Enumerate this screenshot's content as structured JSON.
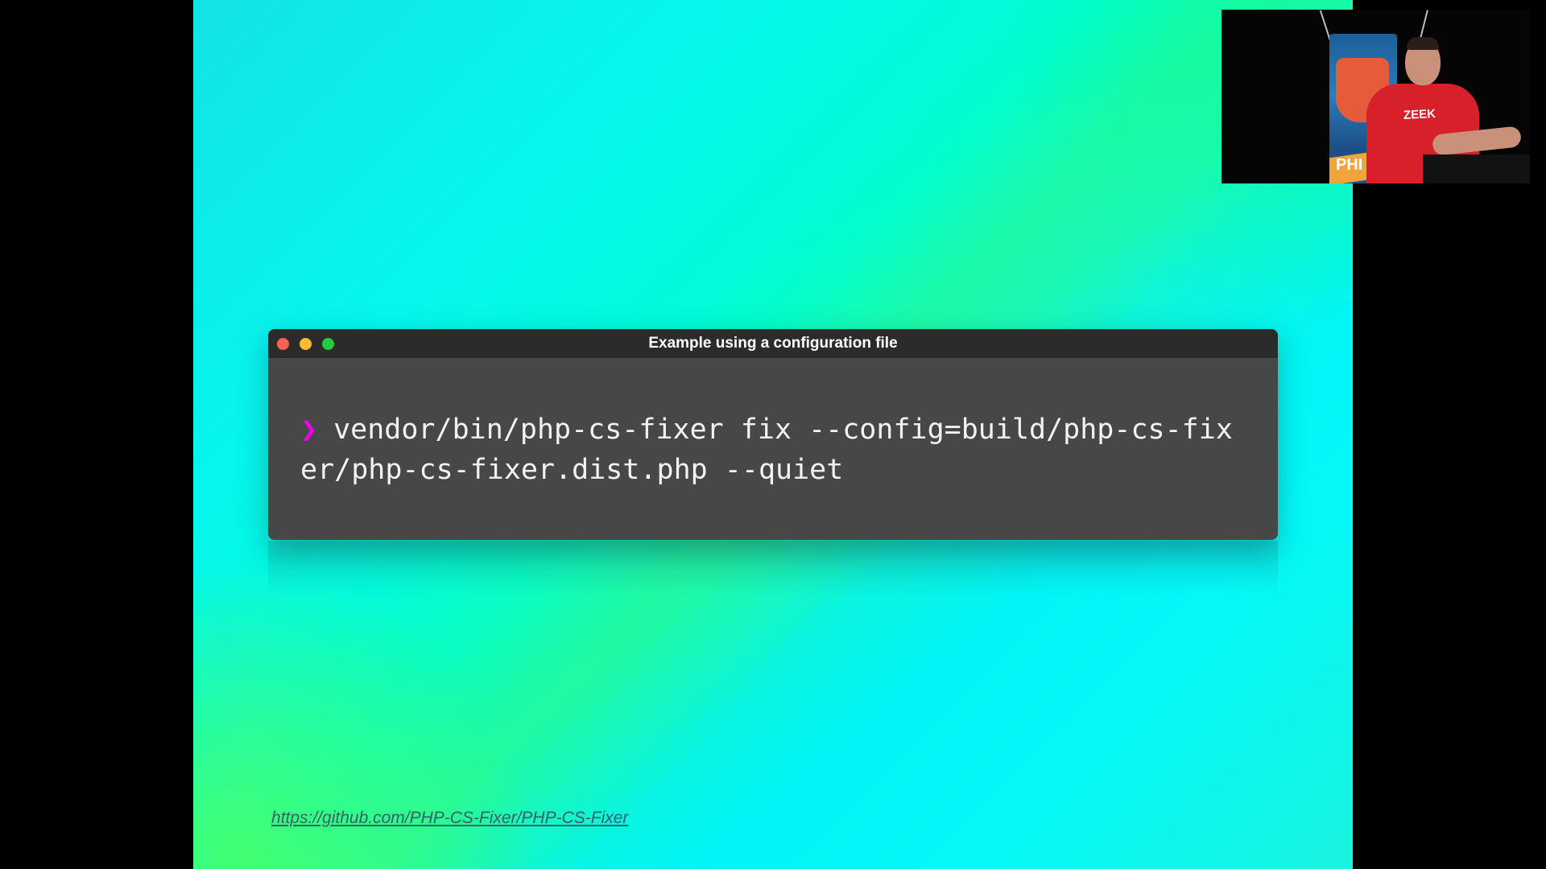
{
  "slide": {
    "terminal": {
      "title": "Example using a configuration file",
      "prompt_symbol": "❯",
      "command": "vendor/bin/php-cs-fixer fix --config=build/php-cs-fixer/php-cs-fixer.dist.php --quiet"
    },
    "source_link": "https://github.com/PHP-CS-Fixer/PHP-CS-Fixer"
  },
  "speaker_cam": {
    "shirt_text": "ZEEK",
    "banner_text": "PHI"
  },
  "colors": {
    "prompt": "#ee00e6",
    "terminal_bg": "#474747",
    "titlebar_bg": "#2b2b2b",
    "close": "#fe5f57",
    "minimize": "#febc2e",
    "maximize": "#28c840"
  }
}
